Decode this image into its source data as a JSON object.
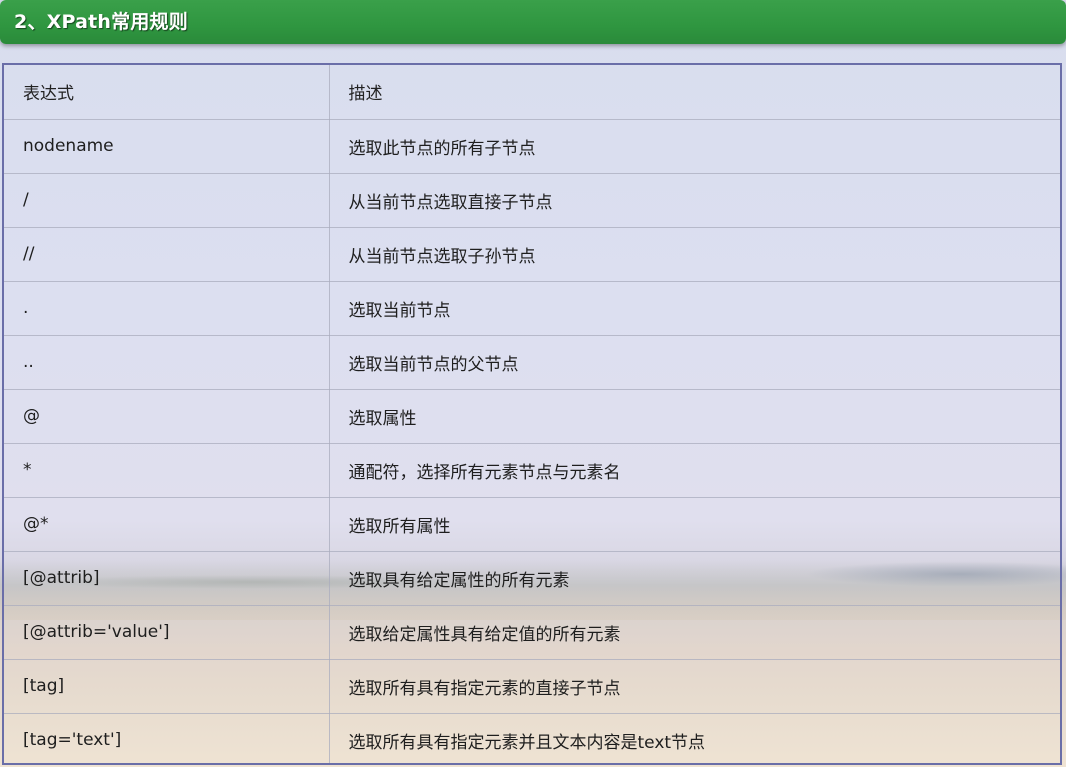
{
  "section": {
    "title": "2、XPath常用规则"
  },
  "table": {
    "headers": [
      "表达式",
      "描述"
    ],
    "rows": [
      [
        "nodename",
        "选取此节点的所有子节点"
      ],
      [
        "/",
        "从当前节点选取直接子节点"
      ],
      [
        "//",
        "从当前节点选取子孙节点"
      ],
      [
        ".",
        "选取当前节点"
      ],
      [
        "..",
        "选取当前节点的父节点"
      ],
      [
        "@",
        "选取属性"
      ],
      [
        "*",
        "通配符，选择所有元素节点与元素名"
      ],
      [
        "@*",
        "选取所有属性"
      ],
      [
        "[@attrib]",
        "选取具有给定属性的所有元素"
      ],
      [
        "[@attrib='value']",
        "选取给定属性具有给定值的所有元素"
      ],
      [
        "[tag]",
        "选取所有具有指定元素的直接子节点"
      ],
      [
        "[tag='text']",
        "选取所有具有指定元素并且文本内容是text节点"
      ]
    ]
  },
  "colors": {
    "header_bg": "#2f9640",
    "table_border": "#6a6ea8"
  }
}
